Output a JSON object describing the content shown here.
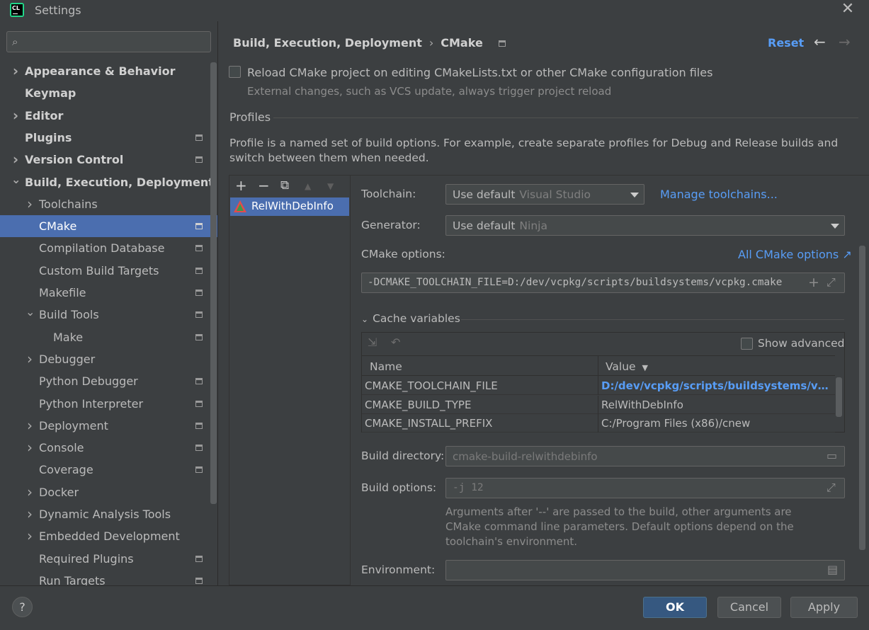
{
  "window": {
    "title": "Settings",
    "close_glyph": "✕"
  },
  "search": {
    "placeholder": "",
    "icon": "search-icon"
  },
  "sidebar": {
    "items": [
      {
        "label": "Appearance & Behavior",
        "bold": true,
        "chevron": "right",
        "indent": 0,
        "page_icon": false
      },
      {
        "label": "Keymap",
        "bold": true,
        "chevron": "none",
        "indent": 0,
        "page_icon": false
      },
      {
        "label": "Editor",
        "bold": true,
        "chevron": "right",
        "indent": 0,
        "page_icon": false
      },
      {
        "label": "Plugins",
        "bold": true,
        "chevron": "none",
        "indent": 0,
        "page_icon": true
      },
      {
        "label": "Version Control",
        "bold": true,
        "chevron": "right",
        "indent": 0,
        "page_icon": true
      },
      {
        "label": "Build, Execution, Deployment",
        "bold": true,
        "chevron": "down",
        "indent": 0,
        "page_icon": false
      },
      {
        "label": "Toolchains",
        "bold": false,
        "chevron": "right",
        "indent": 1,
        "page_icon": false
      },
      {
        "label": "CMake",
        "bold": false,
        "chevron": "none",
        "indent": 1,
        "page_icon": true,
        "selected": true
      },
      {
        "label": "Compilation Database",
        "bold": false,
        "chevron": "none",
        "indent": 1,
        "page_icon": true
      },
      {
        "label": "Custom Build Targets",
        "bold": false,
        "chevron": "none",
        "indent": 1,
        "page_icon": true
      },
      {
        "label": "Makefile",
        "bold": false,
        "chevron": "none",
        "indent": 1,
        "page_icon": true
      },
      {
        "label": "Build Tools",
        "bold": false,
        "chevron": "down",
        "indent": 1,
        "page_icon": true
      },
      {
        "label": "Make",
        "bold": false,
        "chevron": "none",
        "indent": 2,
        "page_icon": true
      },
      {
        "label": "Debugger",
        "bold": false,
        "chevron": "right",
        "indent": 1,
        "page_icon": false
      },
      {
        "label": "Python Debugger",
        "bold": false,
        "chevron": "none",
        "indent": 1,
        "page_icon": true
      },
      {
        "label": "Python Interpreter",
        "bold": false,
        "chevron": "none",
        "indent": 1,
        "page_icon": true
      },
      {
        "label": "Deployment",
        "bold": false,
        "chevron": "right",
        "indent": 1,
        "page_icon": true
      },
      {
        "label": "Console",
        "bold": false,
        "chevron": "right",
        "indent": 1,
        "page_icon": true
      },
      {
        "label": "Coverage",
        "bold": false,
        "chevron": "none",
        "indent": 1,
        "page_icon": true
      },
      {
        "label": "Docker",
        "bold": false,
        "chevron": "right",
        "indent": 1,
        "page_icon": false
      },
      {
        "label": "Dynamic Analysis Tools",
        "bold": false,
        "chevron": "right",
        "indent": 1,
        "page_icon": false
      },
      {
        "label": "Embedded Development",
        "bold": false,
        "chevron": "right",
        "indent": 1,
        "page_icon": false
      },
      {
        "label": "Required Plugins",
        "bold": false,
        "chevron": "none",
        "indent": 1,
        "page_icon": true
      },
      {
        "label": "Run Targets",
        "bold": false,
        "chevron": "none",
        "indent": 1,
        "page_icon": true
      }
    ]
  },
  "header": {
    "breadcrumb_parent": "Build, Execution, Deployment",
    "breadcrumb_sep": "›",
    "breadcrumb_current": "CMake",
    "reset": "Reset",
    "back_glyph": "←",
    "forward_glyph": "→"
  },
  "reload": {
    "checked": false,
    "label": "Reload CMake project on editing CMakeLists.txt or other CMake configuration files",
    "hint": "External changes, such as VCS update, always trigger project reload"
  },
  "profiles": {
    "title": "Profiles",
    "description": "Profile is a named set of build options. For example, create separate profiles for Debug and Release builds and switch between them when needed.",
    "toolbar": {
      "add": "+",
      "remove": "−",
      "copy": "⧉",
      "up": "▲",
      "down": "▼"
    },
    "list": [
      {
        "name": "RelWithDebInfo",
        "selected": true
      }
    ]
  },
  "form": {
    "toolchain": {
      "label": "Toolchain:",
      "value": "Use default",
      "value_hint": "Visual Studio",
      "manage_link": "Manage toolchains..."
    },
    "generator": {
      "label": "Generator:",
      "value": "Use default",
      "value_hint": "Ninja"
    },
    "cmake_options": {
      "label": "CMake options:",
      "all_link": "All CMake options ↗",
      "value": "-DCMAKE_TOOLCHAIN_FILE=D:/dev/vcpkg/scripts/buildsystems/vcpkg.cmake"
    },
    "cache": {
      "title": "Cache variables",
      "show_advanced": "Show advanced",
      "show_advanced_checked": false,
      "columns": {
        "name": "Name",
        "value": "Value"
      },
      "rows": [
        {
          "name": "CMAKE_TOOLCHAIN_FILE",
          "value": "D:/dev/vcpkg/scripts/buildsystems/vcpkg.cmake",
          "modified": true
        },
        {
          "name": "CMAKE_BUILD_TYPE",
          "value": "RelWithDebInfo",
          "modified": false
        },
        {
          "name": "CMAKE_INSTALL_PREFIX",
          "value": "C:/Program Files (x86)/cnew",
          "modified": false
        }
      ]
    },
    "build_directory": {
      "label": "Build directory:",
      "placeholder": "cmake-build-relwithdebinfo"
    },
    "build_options": {
      "label": "Build options:",
      "placeholder": "-j 12",
      "hint": "Arguments after '--' are passed to the build, other arguments are CMake command line parameters. Default options depend on the toolchain's environment."
    },
    "environment": {
      "label": "Environment:",
      "value": ""
    }
  },
  "footer": {
    "help": "?",
    "ok": "OK",
    "cancel": "Cancel",
    "apply": "Apply"
  },
  "colors": {
    "accent": "#589df6",
    "selection": "#4b6eaf",
    "background": "#3c3f41"
  }
}
